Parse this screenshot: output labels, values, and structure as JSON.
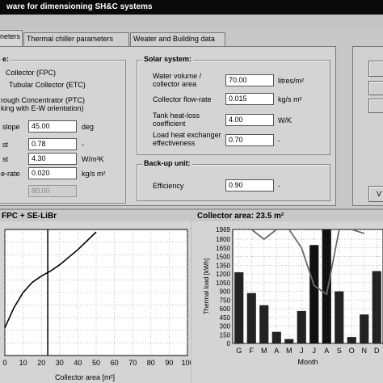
{
  "window": {
    "title": "ware for dimensioning SH&C systems"
  },
  "tabs": [
    "neters",
    "Thermal chiller parameters",
    "Weater and Building data"
  ],
  "collector": {
    "group_title": "e:",
    "types": [
      "Collector (FPC)",
      "Tubular Collector (ETC)",
      "rough Concentrator (PTC)",
      "king with E-W orientation)"
    ],
    "slope_label": "slope",
    "slope_value": "45.00",
    "slope_unit": "deg",
    "row2_label": "st",
    "row2_value": "0.78",
    "row2_unit": "-",
    "row3_label": "st",
    "row3_value": "4.30",
    "row3_unit": "W/m²K",
    "row4_label": "e-rate",
    "row4_value": "0.020",
    "row4_unit": "kg/s m²",
    "row5_value": "80.00"
  },
  "solar": {
    "group_title": "Solar system:",
    "water_label": "Water volume / collector area",
    "water_value": "70.00",
    "water_unit": "litres/m²",
    "flow_label": "Collector flow-rate",
    "flow_value": "0.015",
    "flow_unit": "kg/s m²",
    "tank_label": "Tank heat-loss coefficient",
    "tank_value": "4.00",
    "tank_unit": "W/K",
    "hx_label": "Load heat exchanger effectiveness",
    "hx_value": "0.70",
    "hx_unit": "-"
  },
  "backup": {
    "group_title": "Back-up unit:",
    "eff_label": "Efficiency",
    "eff_value": "0.90",
    "eff_unit": "-"
  },
  "side_buttons": {
    "bottom_label": "V"
  },
  "left_plot": {
    "title": "FPC + SE-LiBr",
    "xlabel": "Collector area  [m²]"
  },
  "right_plot": {
    "title": "Collector area: 23.5 m²",
    "xlabel": "Month",
    "ylabel": "Thermal load [kWh]"
  },
  "chart_data": [
    {
      "type": "line",
      "title": "FPC + SE-LiBr",
      "xlabel": "Collector area  [m²]",
      "ylabel": "",
      "xlim": [
        0,
        100
      ],
      "x_ticks": [
        0,
        10,
        20,
        30,
        40,
        50,
        60,
        70,
        80,
        90,
        100
      ],
      "marker_x": 23.5,
      "series": [
        {
          "x": [
            0,
            5,
            10,
            15,
            20,
            25,
            30,
            40,
            50
          ],
          "y": [
            0.22,
            0.38,
            0.5,
            0.58,
            0.63,
            0.67,
            0.72,
            0.84,
            0.98
          ]
        }
      ]
    },
    {
      "type": "bar",
      "title": "Collector area: 23.5 m²",
      "xlabel": "Month",
      "ylabel": "Thermal load [kWh]",
      "ylim": [
        0,
        1969
      ],
      "y_ticks": [
        0,
        150,
        300,
        450,
        600,
        750,
        900,
        1050,
        1200,
        1350,
        1500,
        1650,
        1800,
        1969
      ],
      "categories": [
        "G",
        "F",
        "M",
        "A",
        "M",
        "J",
        "J",
        "A",
        "S",
        "O",
        "N",
        "D"
      ],
      "series": [
        {
          "values": [
            1230,
            870,
            660,
            200,
            75,
            560,
            1700,
            1969,
            900,
            110,
            500,
            1250
          ]
        },
        {
          "values": [
            null,
            1969,
            1800,
            1969,
            1969,
            1650,
            1000,
            850,
            1969,
            1969,
            1900,
            null
          ]
        }
      ],
      "bar_colors": [
        "#222222",
        "#222222",
        "#222222",
        "#222222",
        "#222222",
        "#222222",
        "#111111",
        "#111111",
        "#222222",
        "#222222",
        "#222222",
        "#222222"
      ]
    }
  ]
}
